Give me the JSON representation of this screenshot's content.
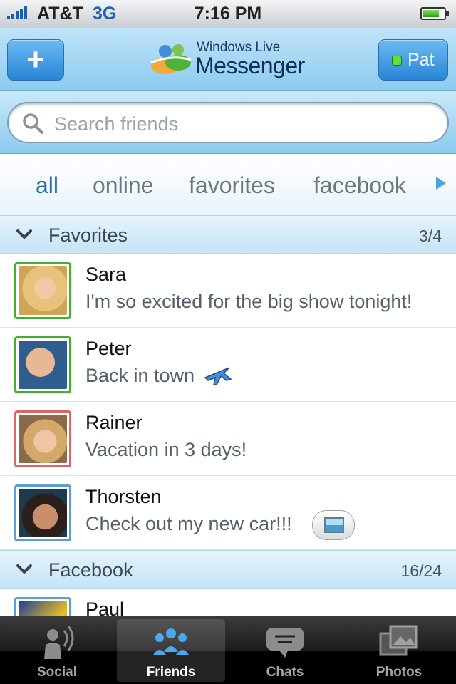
{
  "status_bar": {
    "carrier": "AT&T",
    "network": "3G",
    "time": "7:16 PM"
  },
  "header": {
    "add_button_label": "+",
    "brand_top": "Windows Live",
    "brand_product": "Messenger",
    "user_button_label": "Pat"
  },
  "search": {
    "placeholder": "Search friends"
  },
  "filters": [
    {
      "label": "all",
      "active": true
    },
    {
      "label": "online",
      "active": false
    },
    {
      "label": "favorites",
      "active": false
    },
    {
      "label": "facebook",
      "active": false
    }
  ],
  "sections": [
    {
      "title": "Favorites",
      "count": "3/4",
      "contacts": [
        {
          "name": "Sara",
          "status": "I'm so excited for the big show tonight!",
          "presence": "online"
        },
        {
          "name": "Peter",
          "status": "Back in town",
          "presence": "online",
          "icon": "airplane-icon"
        },
        {
          "name": "Rainer",
          "status": "Vacation in 3 days!",
          "presence": "busy"
        },
        {
          "name": "Thorsten",
          "status": "Check out my new car!!!",
          "presence": "offline",
          "icon": "photo-icon"
        }
      ]
    },
    {
      "title": "Facebook",
      "count": "16/24",
      "contacts": [
        {
          "name": "Paul",
          "status": "",
          "presence": "offline"
        }
      ]
    }
  ],
  "tab_bar": [
    {
      "label": "Social",
      "icon": "social-icon",
      "active": false
    },
    {
      "label": "Friends",
      "icon": "friends-icon",
      "active": true
    },
    {
      "label": "Chats",
      "icon": "chats-icon",
      "active": false
    },
    {
      "label": "Photos",
      "icon": "photos-icon",
      "active": false
    }
  ],
  "colors": {
    "accent_blue": "#2a85d6",
    "online_green": "#43b02a",
    "busy_red": "#e06464"
  }
}
